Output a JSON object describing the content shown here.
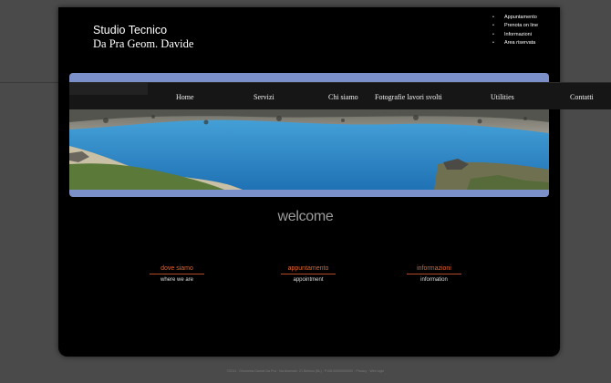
{
  "brand": {
    "line1": "Studio Tecnico",
    "line2": "Da Pra Geom. Davide"
  },
  "top_links": [
    "Appuntamento",
    "Prenota on line",
    "Informazioni",
    "Area riservata"
  ],
  "nav": [
    "Home",
    "Servizi",
    "Chi siamo",
    "Fotografie lavori svolti",
    "Utilities",
    "Contatti"
  ],
  "banner": {
    "image": "mountain-lake-photo"
  },
  "welcome": "welcome",
  "features": [
    {
      "title": "dove siamo",
      "subtitle": "where we are"
    },
    {
      "title": "appuntamento",
      "subtitle": "appointment"
    },
    {
      "title": "informazioni",
      "subtitle": "information"
    }
  ],
  "footer": "©2011 · Geometra Davide Da Pra · Via Arsenale, 21 Belluno (BL) · P.IVA 00000000000 · Privacy · Web login",
  "colors": {
    "accent": "#e0642e",
    "banner_border": "#7b8fc9",
    "page_bg": "#4a4a4a",
    "content_bg": "#000000"
  }
}
